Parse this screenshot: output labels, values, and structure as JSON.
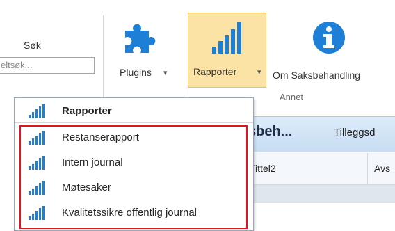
{
  "ribbon": {
    "search_label": "Søk",
    "search_placeholder": "eltsøk...",
    "plugins_label": "Plugins",
    "rapporter_label": "Rapporter",
    "info_label": "Om Saksbehandling",
    "group_label": "Annet",
    "dropdown_caret": "▾"
  },
  "behind": {
    "title": "sbeh...",
    "tab": "Tilleggsd",
    "col_tittel2": "Tittel2",
    "col_avs": "Avs"
  },
  "dropdown": {
    "heading": "Rapporter",
    "items": [
      {
        "label": "Restanserapport"
      },
      {
        "label": "Intern journal"
      },
      {
        "label": "Møtesaker"
      },
      {
        "label": "Kvalitetssikre offentlig journal"
      }
    ]
  },
  "icons": {
    "chart": "bar-chart-icon",
    "puzzle": "puzzle-icon",
    "info": "info-icon"
  },
  "colors": {
    "accent_blue": "#1e7fd6",
    "highlight": "#fbe3a5",
    "red_box": "#e0141e"
  }
}
